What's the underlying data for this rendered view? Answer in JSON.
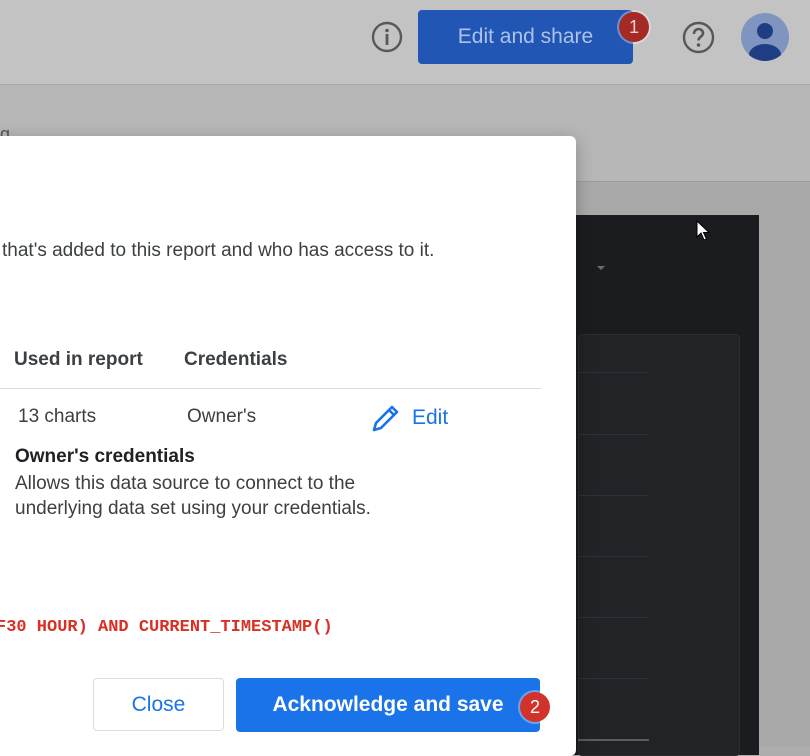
{
  "header": {
    "edit_share_label": "Edit and share",
    "step_badge_1": "1"
  },
  "subbar": {
    "fragment_text": "g"
  },
  "dialog": {
    "intro_text": "that's added to this report and who has access to it.",
    "table": {
      "headers": [
        "Used in report",
        "Credentials"
      ],
      "row": {
        "used_in_report": "13 charts",
        "credentials": "Owner's",
        "edit_label": "Edit"
      }
    },
    "credential_info": {
      "title": "Owner's credentials",
      "description": "Allows this data source to connect to the underlying data set using your credentials."
    },
    "sql_snippet": "F30 HOUR) AND CURRENT_TIMESTAMP()",
    "close_label": "Close",
    "acknowledge_label": "Acknowledge and save",
    "step_badge_2": "2"
  },
  "colors": {
    "primary_blue": "#1a73e8",
    "badge_red": "#d1332c",
    "sql_red": "#d93025"
  },
  "icons": [
    "info-icon",
    "help-icon",
    "avatar-icon",
    "pencil-icon",
    "mouse-cursor-icon"
  ]
}
